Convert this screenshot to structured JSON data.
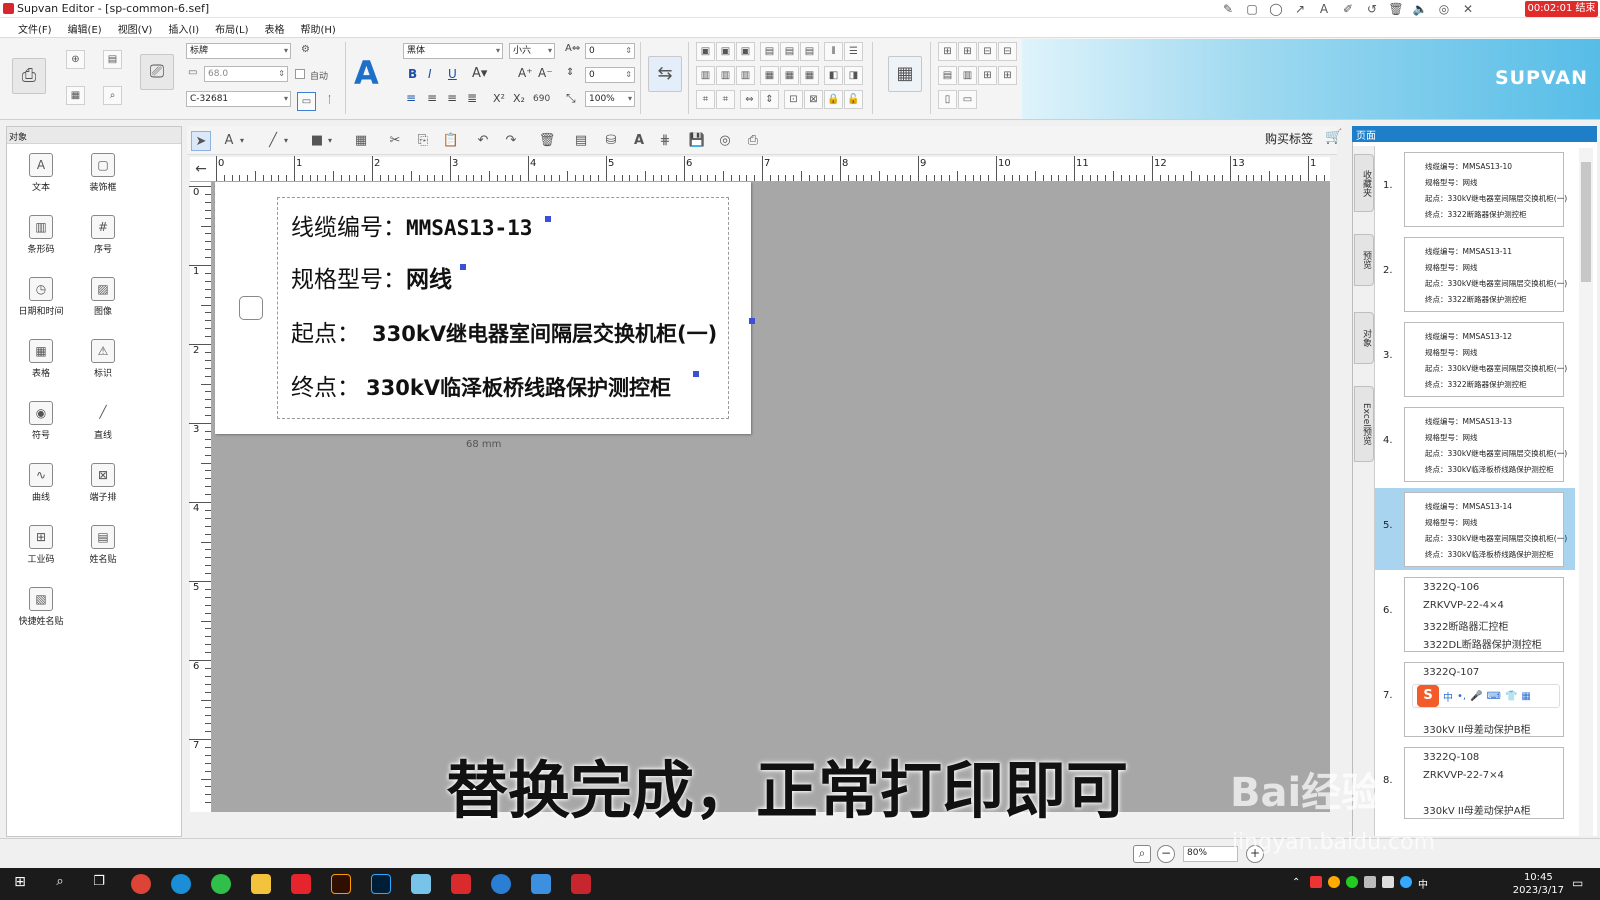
{
  "window": {
    "title": "Supvan Editor - [sp-common-6.sef]"
  },
  "recorder": {
    "stop_label": "00:02:01 结束"
  },
  "menu": [
    "文件(F)",
    "编辑(E)",
    "视图(V)",
    "插入(I)",
    "布局(L)",
    "表格",
    "帮助(H)"
  ],
  "ribbon": {
    "label_type": "标牌",
    "width_value": "68.0",
    "auto_label": "自动",
    "printer_model": "C-32681",
    "font_family": "黑体",
    "font_size": "小六",
    "char_spacing": "0",
    "line_spacing": "0",
    "scale": "100%",
    "rotate_value": "690"
  },
  "brand": {
    "text": "SUPVAN"
  },
  "objects_panel": {
    "header": "对象",
    "items": [
      "文本",
      "装饰框",
      "条形码",
      "序号",
      "日期和时间",
      "图像",
      "表格",
      "标识",
      "符号",
      "直线",
      "曲线",
      "端子排",
      "工业码",
      "姓名贴",
      "快捷姓名贴"
    ]
  },
  "toolbar2": {
    "buy_label": "购买标签"
  },
  "ruler": {
    "h_numbers": [
      "0",
      "1",
      "2",
      "3",
      "4",
      "5",
      "6",
      "7",
      "8",
      "9",
      "10",
      "11",
      "12",
      "13",
      "1"
    ],
    "v_numbers": [
      "0",
      "1",
      "2",
      "3",
      "4",
      "5",
      "6",
      "7"
    ]
  },
  "label": {
    "line1_key": "线缆编号：",
    "line1_val": "MMSAS13-13",
    "line2_key": "规格型号：",
    "line2_val": "网线",
    "line3_key": "起点：",
    "line3_val": "330kV继电器室间隔层交换机柜(一)",
    "line4_key": "终点：",
    "line4_val": "330kV临泽板桥线路保护测控柜",
    "width_note": "68 mm"
  },
  "pages_panel": {
    "header": "页面",
    "side_tabs": [
      "收藏夹",
      "预览",
      "对象",
      "Excel预览"
    ],
    "pages": [
      {
        "num": "1.",
        "lines": [
          "线缆编号：MMSAS13-10",
          "规格型号：网线",
          "起点：330kV继电器室间隔层交换机柜(一)",
          "终点：3322断路器保护测控柜"
        ]
      },
      {
        "num": "2.",
        "lines": [
          "线缆编号：MMSAS13-11",
          "规格型号：网线",
          "起点：330kV继电器室间隔层交换机柜(一)",
          "终点：3322断路器保护测控柜"
        ]
      },
      {
        "num": "3.",
        "lines": [
          "线缆编号：MMSAS13-12",
          "规格型号：网线",
          "起点：330kV继电器室间隔层交换机柜(一)",
          "终点：3322断路器保护测控柜"
        ]
      },
      {
        "num": "4.",
        "lines": [
          "线缆编号：MMSAS13-13",
          "规格型号：网线",
          "起点：330kV继电器室间隔层交换机柜(一)",
          "终点：330kV临泽板桥线路保护测控柜"
        ]
      },
      {
        "num": "5.",
        "lines": [
          "线缆编号：MMSAS13-14",
          "规格型号：网线",
          "起点：330kV继电器室间隔层交换机柜(一)",
          "终点：330kV临泽板桥线路保护测控柜"
        ]
      },
      {
        "num": "6.",
        "lines": [
          "3322Q-106",
          "ZRKVVP-22-4×4",
          "3322断路器汇控柜",
          "3322DL断路器保护测控柜"
        ]
      },
      {
        "num": "7.",
        "lines": [
          "3322Q-107",
          "",
          "",
          "330kV II母差动保护B柜"
        ]
      },
      {
        "num": "8.",
        "lines": [
          "3322Q-108",
          "ZRKVVP-22-7×4",
          "",
          "330kV II母差动保护A柜"
        ]
      }
    ]
  },
  "zoom": {
    "level": "80%"
  },
  "subtitle": "替换完成，正常打印即可",
  "watermark": {
    "main": "Bai经验",
    "sub": "jingyan.baidu.com"
  },
  "taskbar": {
    "time": "10:45",
    "date": "2023/3/17"
  }
}
